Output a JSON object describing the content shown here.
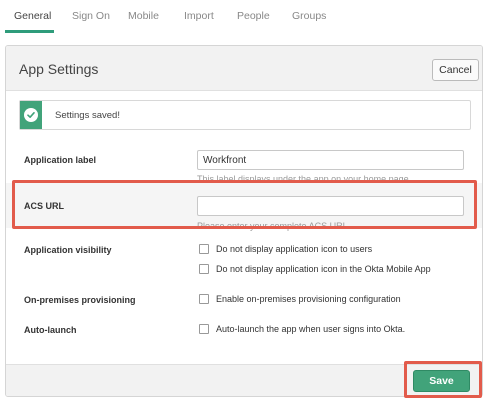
{
  "tabs": [
    {
      "label": "General",
      "active": true
    },
    {
      "label": "Sign On"
    },
    {
      "label": "Mobile"
    },
    {
      "label": "Import"
    },
    {
      "label": "People"
    },
    {
      "label": "Groups"
    }
  ],
  "panel": {
    "title": "App Settings",
    "cancel_label": "Cancel",
    "save_label": "Save"
  },
  "alert": {
    "text": "Settings saved!",
    "icon": "check-icon"
  },
  "form": {
    "app_label": {
      "label": "Application label",
      "value": "Workfront",
      "hint": "This label displays under the app on your home page"
    },
    "acs_url": {
      "label": "ACS URL",
      "value": "",
      "hint": "Please enter your complete ACS URL."
    },
    "visibility": {
      "label": "Application visibility",
      "option1": "Do not display application icon to users",
      "option2": "Do not display application icon in the Okta Mobile App"
    },
    "provisioning": {
      "label": "On-premises provisioning",
      "option": "Enable on-premises provisioning configuration"
    },
    "auto_launch": {
      "label": "Auto-launch",
      "option": "Auto-launch the app when user signs into Okta."
    }
  },
  "colors": {
    "accent": "#41a37a",
    "highlight": "#e25b4b"
  }
}
